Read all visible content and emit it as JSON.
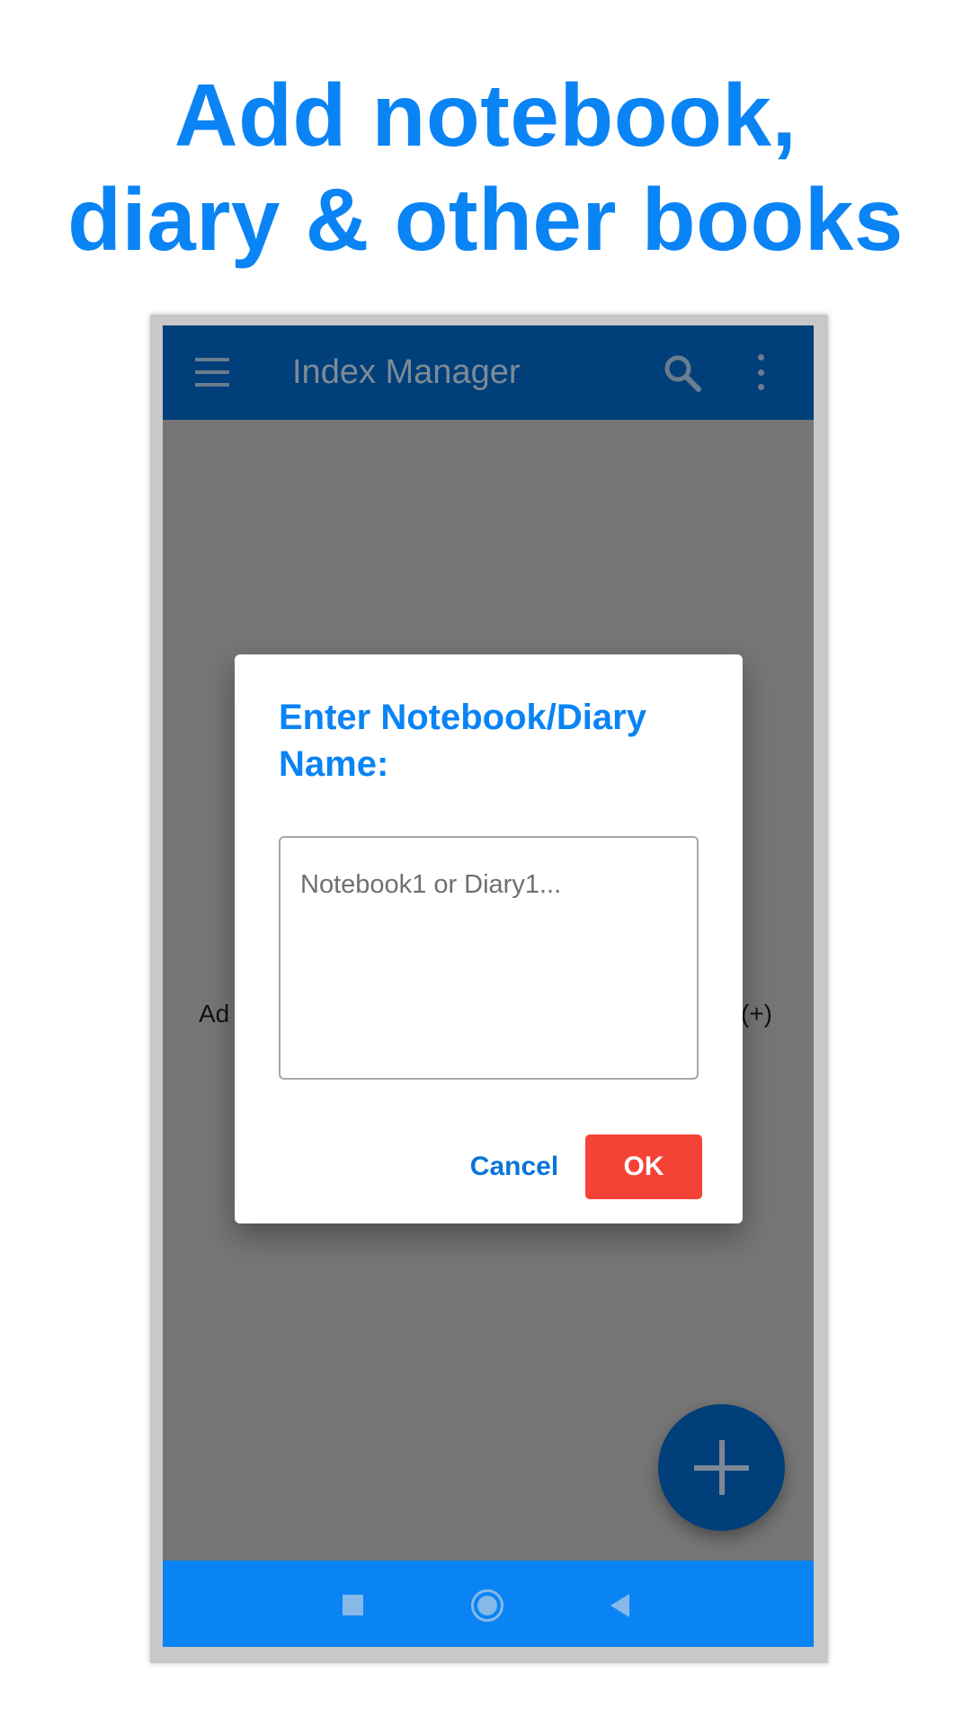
{
  "headline": {
    "line1": "Add notebook,",
    "line2": "diary & other books"
  },
  "app_bar": {
    "title": "Index Manager",
    "icons": [
      "menu-icon",
      "search-icon",
      "more-vert-icon"
    ]
  },
  "background_hint": {
    "left_fragment": "Ad",
    "right_fragment": "(+)"
  },
  "dialog": {
    "title": "Enter Notebook/Diary Name:",
    "input_value": "",
    "input_placeholder": "Notebook1 or Diary1...",
    "cancel_label": "Cancel",
    "ok_label": "OK"
  },
  "fab": {
    "icon": "plus-icon"
  },
  "nav_bar": {
    "icons": [
      "recents-icon",
      "home-icon",
      "back-icon"
    ]
  },
  "colors": {
    "headline": "#0a84f5",
    "app_bar_dimmed": "#003f7a",
    "ok_button": "#f44336",
    "nav_bar": "#0a84f5"
  }
}
